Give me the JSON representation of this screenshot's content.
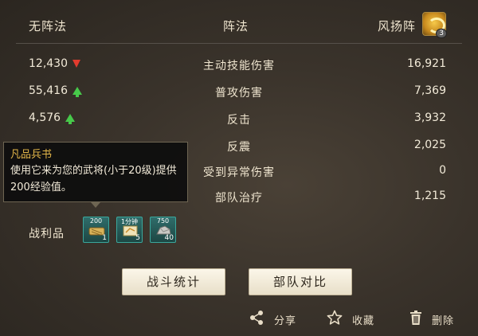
{
  "header": {
    "left_label": "无阵法",
    "middle_label": "阵法",
    "right_label": "风扬阵",
    "formation_level": "3"
  },
  "stats": [
    {
      "left": "12,430",
      "trend": "down",
      "label": "主动技能伤害",
      "right": "16,921"
    },
    {
      "left": "55,416",
      "trend": "up",
      "label": "普攻伤害",
      "right": "7,369"
    },
    {
      "left": "4,576",
      "trend": "up",
      "label": "反击",
      "right": "3,932"
    },
    {
      "left": "",
      "trend": "",
      "label": "反震",
      "right": "2,025"
    },
    {
      "left": "",
      "trend": "",
      "label": "受到异常伤害",
      "right": "0"
    },
    {
      "left": "",
      "trend": "",
      "label": "部队治疗",
      "right": "1,215"
    }
  ],
  "tooltip": {
    "title": "凡品兵书",
    "description": "使用它来为您的武将(小于20级)提供200经验值。"
  },
  "loot": {
    "label": "战利品",
    "items": [
      {
        "name": "scroll-book-icon",
        "top": "200",
        "count": "1"
      },
      {
        "name": "speed-scroll-icon",
        "top": "1分钟",
        "count": "5"
      },
      {
        "name": "stone-ore-icon",
        "top": "750",
        "count": "40"
      }
    ]
  },
  "buttons": {
    "battle_stats": "战斗统计",
    "troop_compare": "部队对比"
  },
  "actions": {
    "share": "分享",
    "favorite": "收藏",
    "delete": "删除"
  },
  "colors": {
    "arrow_up": "#47c94a",
    "arrow_down": "#e23b2e",
    "tooltip_title": "#e6b84a"
  }
}
